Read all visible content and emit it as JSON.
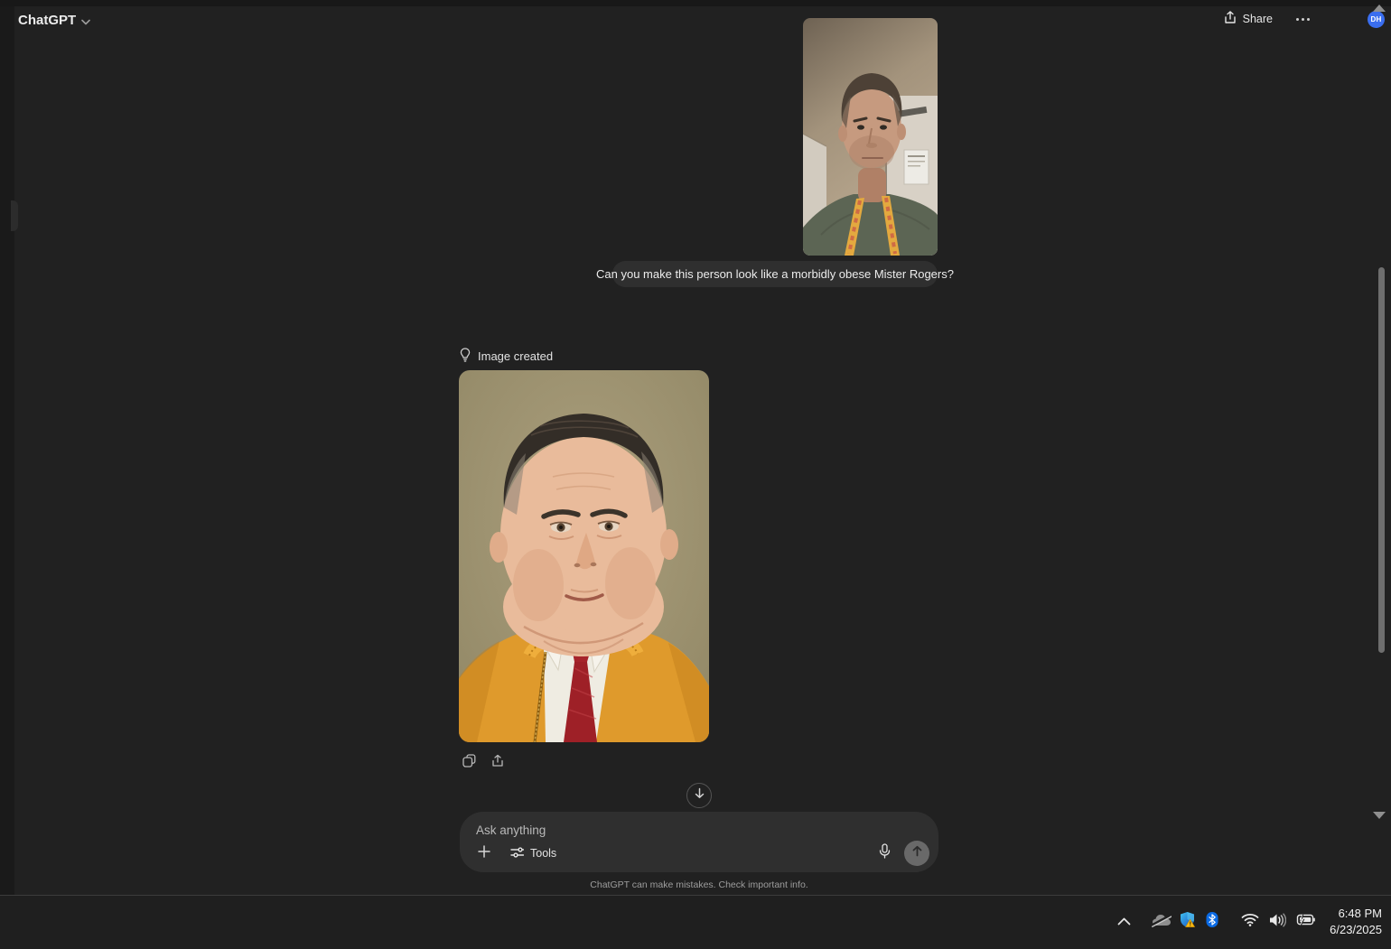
{
  "header": {
    "app_title": "ChatGPT",
    "share_label": "Share",
    "avatar_initials": "DH"
  },
  "chat": {
    "user": {
      "message": "Can you make this person look like a morbidly obese Mister Rogers?",
      "photo_description": "Uploaded selfie of a man with short hair wearing a green shirt and an orange lanyard, ceiling and door behind him"
    },
    "assistant": {
      "status_label": "Image created",
      "image_description": "Generated portrait of a very heavyset man with slicked dark hair wearing a mustard zip-up cardigan, white shirt and red tie"
    }
  },
  "composer": {
    "placeholder": "Ask anything",
    "tools_label": "Tools"
  },
  "footer": {
    "disclaimer": "ChatGPT can make mistakes. Check important info."
  },
  "taskbar": {
    "time": "6:48 PM",
    "date": "6/23/2025"
  },
  "icons": {
    "header": [
      "chevron-down-icon",
      "share-icon",
      "more-options-icon"
    ],
    "message": [
      "lightbulb-icon",
      "copy-icon",
      "upload-icon"
    ],
    "composer": [
      "plus-icon",
      "sliders-icon",
      "microphone-icon",
      "send-arrow-icon"
    ],
    "scroll": [
      "arrow-down-icon",
      "scroll-up-arrow",
      "scroll-down-arrow"
    ],
    "tray": [
      "chevron-up-icon",
      "cloud-offline-icon",
      "security-shield-icon",
      "bluetooth-icon",
      "wifi-icon",
      "volume-icon",
      "battery-charging-icon"
    ]
  },
  "colors": {
    "app_background": "#212121",
    "bubble": "#2f2f2f",
    "composer": "#2f2f2f",
    "avatar_blue": "#3a6ef0",
    "cardigan_orange": "#df9a2c",
    "tie_red": "#a6242b",
    "taskbar": "#1f1f1f"
  }
}
